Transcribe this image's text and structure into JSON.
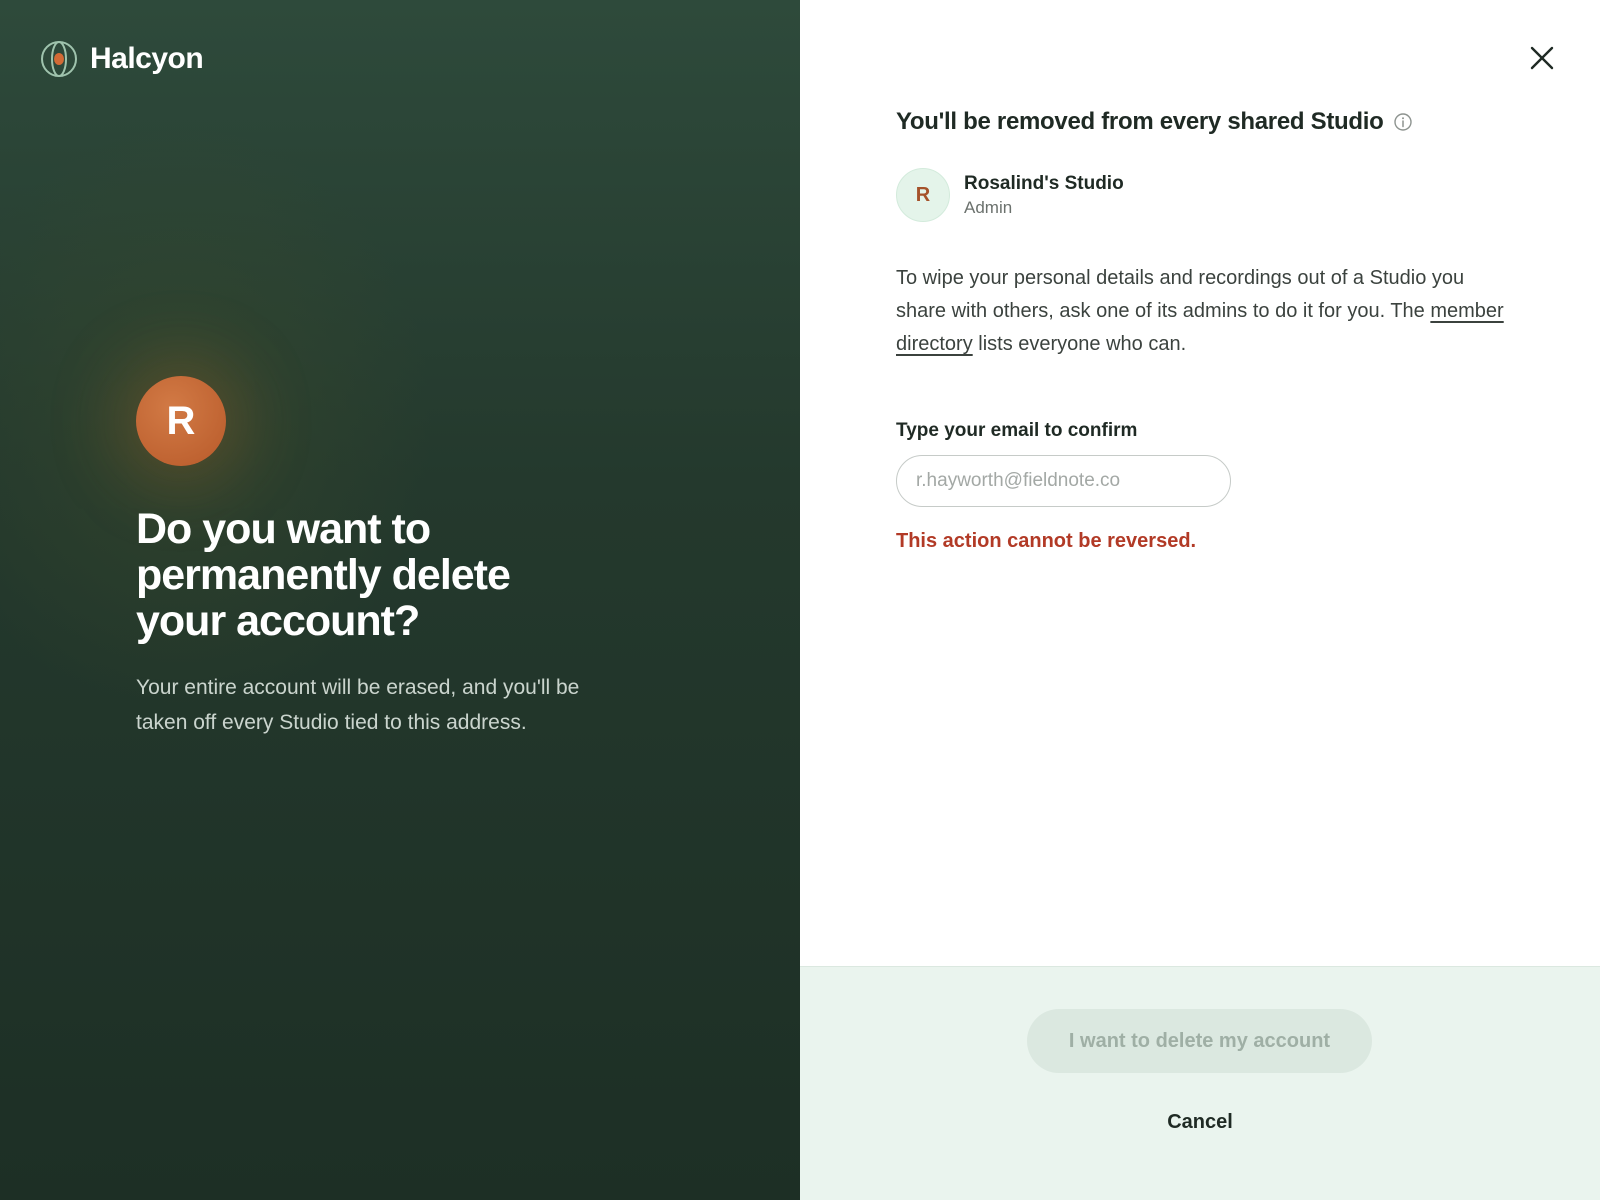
{
  "brand": {
    "name": "Halcyon",
    "icon": "halcyon-logo-icon"
  },
  "hero": {
    "avatar_initial": "R",
    "headline_lines": [
      "Do you want to",
      "permanently delete",
      "your account?"
    ],
    "subtext": "Your entire account will be erased, and you'll be taken off every Studio tied to this address."
  },
  "dialog": {
    "close_icon": "close-icon",
    "section_title": "You'll be removed from every shared Studio",
    "info_icon": "info-icon",
    "studio": {
      "initial": "R",
      "name": "Rosalind's Studio",
      "role": "Admin"
    },
    "paragraph": {
      "before_link": "To wipe your personal details and recordings out of a Studio you share with others, ask one of its admins to do it for you. The ",
      "link_text": "member directory",
      "after_link": " lists everyone who can."
    },
    "email": {
      "label": "Type your email to confirm",
      "placeholder": "r.hayworth@fieldnote.co",
      "value": ""
    },
    "warning": "This action cannot be reversed."
  },
  "footer": {
    "delete_label": "I want to delete my account",
    "cancel_label": "Cancel"
  },
  "colors": {
    "left_panel": "#24392d",
    "accent_orange": "#c0632f",
    "warning_red": "#b23a26",
    "footer_bg": "#eaf4ee",
    "disabled_button": "#dbe8e0"
  }
}
